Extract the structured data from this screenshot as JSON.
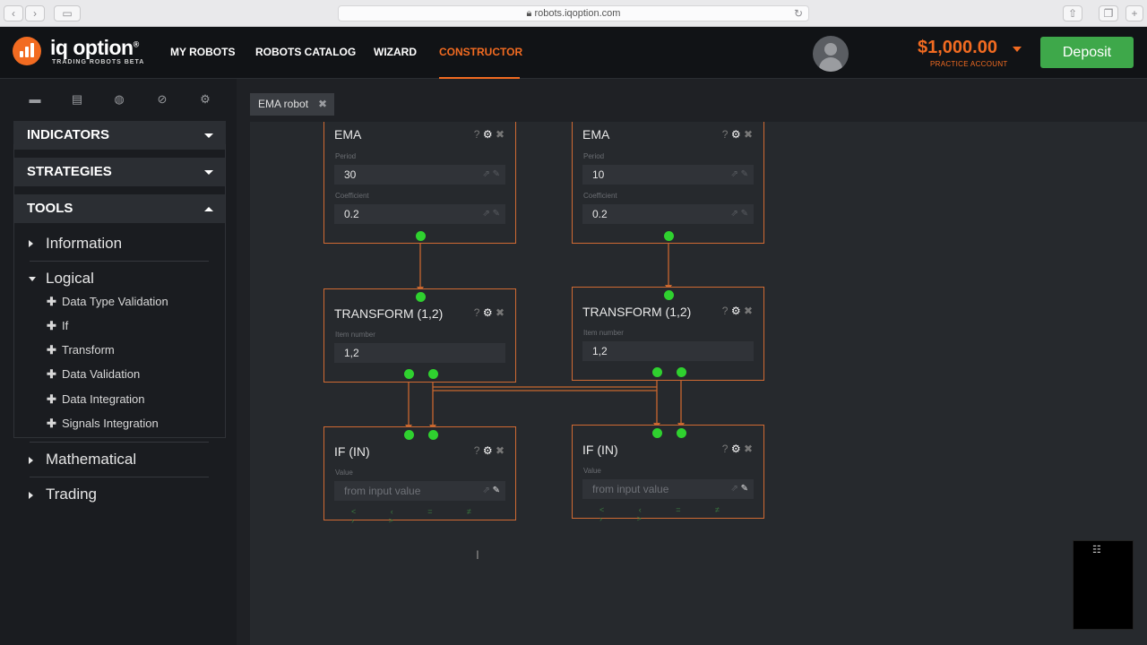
{
  "browser": {
    "url": "robots.iqoption.com",
    "back": "‹",
    "forward": "›"
  },
  "brand": {
    "name": "iq option",
    "registered": "®",
    "sub": "TRADING ROBOTS BETA",
    "color": "#f26b21"
  },
  "nav": {
    "items": [
      "MY ROBOTS",
      "ROBOTS CATALOG",
      "WIZARD",
      "CONSTRUCTOR"
    ],
    "active": "CONSTRUCTOR"
  },
  "account": {
    "balance": "$1,000.00",
    "type": "PRACTICE ACCOUNT",
    "deposit_label": "Deposit"
  },
  "toolbar_icons": [
    "folder-icon",
    "save-icon",
    "gamepad-icon",
    "eye-slash-icon",
    "gear-icon"
  ],
  "sidebar": {
    "sections": [
      {
        "label": "INDICATORS",
        "expanded": false
      },
      {
        "label": "STRATEGIES",
        "expanded": false
      },
      {
        "label": "TOOLS",
        "expanded": true
      }
    ],
    "tools": {
      "information": "Information",
      "logical": "Logical",
      "logical_items": [
        "Data Type Validation",
        "If",
        "Transform",
        "Data Validation",
        "Data Integration",
        "Signals Integration"
      ],
      "mathematical": "Mathematical",
      "trading": "Trading"
    }
  },
  "tab": {
    "label": "EMA robot",
    "close": "✖"
  },
  "nodes": {
    "ema_left": {
      "title": "EMA",
      "period_label": "Period",
      "period": "30",
      "coef_label": "Coefficient",
      "coef": "0.2"
    },
    "ema_right": {
      "title": "EMA",
      "period_label": "Period",
      "period": "10",
      "coef_label": "Coefficient",
      "coef": "0.2"
    },
    "transform_left": {
      "title": "TRANSFORM (1,2)",
      "item_label": "Item number",
      "item": "1,2"
    },
    "transform_right": {
      "title": "TRANSFORM (1,2)",
      "item_label": "Item number",
      "item": "1,2"
    },
    "if_left": {
      "title": "IF (IN)",
      "value_label": "Value",
      "placeholder": "from input value",
      "ops": "< ‹ = ≠ › >"
    },
    "if_right": {
      "title": "IF (IN)",
      "value_label": "Value",
      "placeholder": "from input value",
      "ops": "< ‹ = ≠ › >"
    }
  },
  "node_icons": {
    "help": "?",
    "settings": "⚙",
    "close": "✖"
  },
  "colors": {
    "accent": "#f26b21",
    "connector": "#2fd12f",
    "node_border": "#d06a33",
    "deposit": "#3ea84a"
  }
}
